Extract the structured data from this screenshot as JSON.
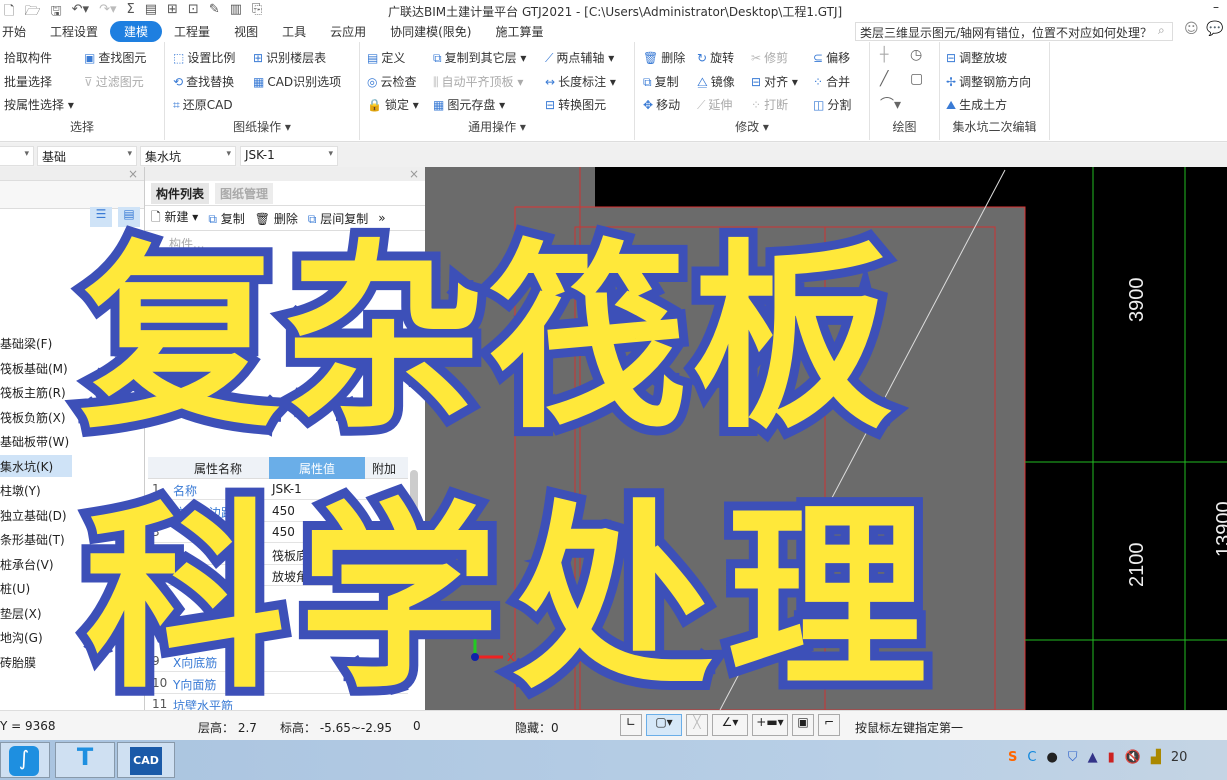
{
  "window": {
    "title": "广联达BIM土建计量平台 GTJ2021 - [C:\\Users\\Administrator\\Desktop\\工程1.GTJ]",
    "minimize": "–"
  },
  "menu_tabs": [
    "开始",
    "工程设置",
    "建模",
    "工程量",
    "视图",
    "工具",
    "云应用",
    "协同建模(限免)",
    "施工算量"
  ],
  "active_tab": "建模",
  "help_search": {
    "value": "类层三维显示图元/轴网有错位，位置不对应如何处理？"
  },
  "ribbon": {
    "select": {
      "label": "选择",
      "items": [
        "拾取构件",
        "批量选择",
        "按属性选择 ▾",
        "查找图元",
        "过滤图元"
      ]
    },
    "drawing": {
      "label": "图纸操作 ▾",
      "items": [
        "设置比例",
        "查找替换",
        "还原CAD",
        "识别楼层表",
        "CAD识别选项"
      ]
    },
    "general": {
      "label": "通用操作 ▾",
      "items": [
        "定义",
        "云检查",
        "锁定 ▾",
        "复制到其它层 ▾",
        "自动平齐顶板 ▾",
        "图元存盘 ▾",
        "两点辅轴 ▾",
        "长度标注 ▾",
        "转换图元"
      ]
    },
    "modify": {
      "label": "修改 ▾",
      "items": [
        "删除",
        "复制",
        "移动",
        "旋转",
        "镜像",
        "延伸",
        "修剪",
        "对齐 ▾",
        "打断",
        "偏移",
        "合并",
        "分割"
      ]
    },
    "draw": {
      "label": "绘图"
    },
    "pit_edit": {
      "label": "集水坑二次编辑",
      "items": [
        "调整放坡",
        "调整钢筋方向",
        "生成土方"
      ]
    }
  },
  "selectors": [
    "基础",
    "集水坑",
    "JSK-1"
  ],
  "left_panel": {
    "items": [
      "基础梁(F)",
      "筏板基础(M)",
      "筏板主筋(R)",
      "筏板负筋(X)",
      "基础板带(W)",
      "集水坑(K)",
      "柱墩(Y)",
      "独立基础(D)",
      "条形基础(T)",
      "桩承台(V)",
      "桩(U)",
      "垫层(X)",
      "地沟(G)",
      "砖胎膜"
    ],
    "selected": "集水坑(K)"
  },
  "component_panel": {
    "tabs": [
      "构件列表",
      "图纸管理"
    ],
    "toolbar": [
      "新建 ▾",
      "复制",
      "删除",
      "层间复制"
    ],
    "search_placeholder": "构件..."
  },
  "properties": {
    "headers": [
      "属性名称",
      "属性值",
      "附加"
    ],
    "rows": [
      [
        "1",
        "名称",
        "JSK-1"
      ],
      [
        "2",
        "坑底出边距离(...",
        "450"
      ],
      [
        "3",
        "",
        "450"
      ],
      [
        "4",
        "",
        "筏板底"
      ],
      [
        "5",
        "",
        "放坡角"
      ],
      [
        "9",
        "X向底筋",
        ""
      ],
      [
        "10",
        "Y向面筋",
        ""
      ],
      [
        "11",
        "坑壁水平筋",
        ""
      ]
    ]
  },
  "canvas": {
    "dims": [
      "3900",
      "2100",
      "13900"
    ],
    "axis_x": "X"
  },
  "status": {
    "y": "Y = 9368",
    "floor_height": "层高： 2.7",
    "elevation": "标高： -5.65~-2.95",
    "zero": "0",
    "hidden": "隐藏：0",
    "hint": "按鼠标左键指定第一"
  },
  "overlay": {
    "line1": "复杂筏板",
    "line2": "科学处理"
  },
  "taskbar": {
    "cad": "CAD",
    "clock": "20"
  }
}
